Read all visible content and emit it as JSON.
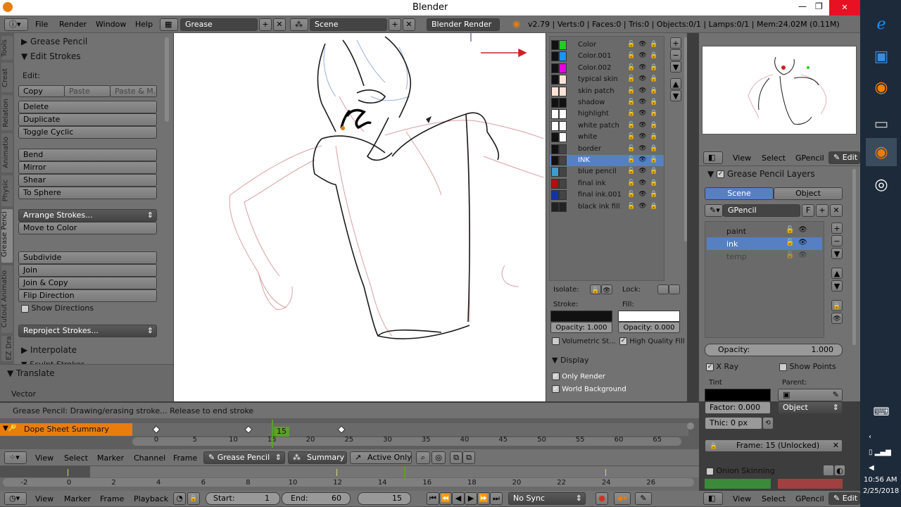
{
  "window": {
    "title": "Blender",
    "minimize": "—",
    "maximize": "❐",
    "close": "✕"
  },
  "topbar": {
    "menus": [
      "File",
      "Render",
      "Window",
      "Help"
    ],
    "screen": "Grease",
    "scene": "Scene",
    "engine": "Blender Render",
    "stats": "v2.79 | Verts:0 | Faces:0 | Tris:0 | Objects:0/1 | Lamps:0/1 | Mem:24.02M (0.11M)"
  },
  "tools": {
    "vtabs": [
      "Tools",
      "Creat",
      "Relation",
      "Animatio",
      "Physic",
      "Grease Penci",
      "Cutout Animatio",
      "EZ Dra"
    ],
    "grease_pencil": "Grease Pencil",
    "edit_strokes": "Edit Strokes",
    "edit_label": "Edit:",
    "copy": "Copy",
    "paste": "Paste",
    "paste_m": "Paste & M...",
    "g1": [
      "Delete",
      "Duplicate",
      "Toggle Cyclic"
    ],
    "g2": [
      "Bend",
      "Mirror",
      "Shear",
      "To Sphere"
    ],
    "arrange": "Arrange Strokes...",
    "move_color": "Move to Color",
    "g3": [
      "Subdivide",
      "Join",
      "Join & Copy",
      "Flip Direction"
    ],
    "show_dirs": "Show Directions",
    "reproject": "Reproject Strokes...",
    "interpolate": "Interpolate",
    "sculpt": "Sculpt Strokes",
    "translate": "Translate",
    "vector": "Vector"
  },
  "status": "Grease Pencil: Drawing/erasing stroke... Release to end stroke",
  "colors": {
    "items": [
      {
        "name": "Color",
        "stroke": "#111111",
        "fill": "#22cc22"
      },
      {
        "name": "Color.001",
        "stroke": "#111111",
        "fill": "#1e90ff"
      },
      {
        "name": "Color.002",
        "stroke": "#111111",
        "fill": "#e600e6"
      },
      {
        "name": "typical skin",
        "stroke": "#111111",
        "fill": "#fde3d6"
      },
      {
        "name": "skin patch",
        "stroke": "#fde3d6",
        "fill": "#fde3d6"
      },
      {
        "name": "shadow",
        "stroke": "#111111",
        "fill": "#111111"
      },
      {
        "name": "highlight",
        "stroke": "#ffffff",
        "fill": "#ffffff"
      },
      {
        "name": "white patch",
        "stroke": "#ffffff",
        "fill": "#ffffff"
      },
      {
        "name": "white",
        "stroke": "#111111",
        "fill": "#ffffff"
      },
      {
        "name": "border",
        "stroke": "#111111",
        "fill": "#444444"
      },
      {
        "name": "INK",
        "stroke": "#111111",
        "fill": "#444444"
      },
      {
        "name": "blue pencil",
        "stroke": "#3aa0c8",
        "fill": "#444444"
      },
      {
        "name": "final ink",
        "stroke": "#aa1111",
        "fill": "#444444"
      },
      {
        "name": "final ink.001",
        "stroke": "#1133aa",
        "fill": "#444444"
      },
      {
        "name": "black ink fill",
        "stroke": "#222222",
        "fill": "#222222"
      }
    ],
    "selected_index": 10,
    "isolate": "Isolate:",
    "lock": "Lock:",
    "stroke": "Stroke:",
    "fill": "Fill:",
    "stroke_opacity": "Opacity: 1.000",
    "fill_opacity": "Opacity: 0.000",
    "volumetric": "Volumetric St...",
    "hq_fill": "High Quality Fill",
    "display": "Display",
    "only_render": "Only Render",
    "world_bg": "World Background"
  },
  "right": {
    "menus": [
      "View",
      "Select",
      "GPencil"
    ],
    "edit": "Edit",
    "layers_title": "Grease Pencil Layers",
    "scene_tab": "Scene",
    "object_tab": "Object",
    "gpencil": "GPencil",
    "f": "F",
    "layers": [
      "paint",
      "ink",
      "temp"
    ],
    "active_layer": 1,
    "opacity_label": "Opacity:",
    "opacity_value": "1.000",
    "xray": "X Ray",
    "show_points": "Show Points",
    "tint": "Tint",
    "parent": "Parent:",
    "factor": "Factor: 0.000",
    "object": "Object",
    "thickness": "Thic: 0 px",
    "frame": "Frame: 15 (Unlocked)",
    "onion": "Onion Skinning"
  },
  "dopesheet": {
    "summary": "Dope Sheet Summary",
    "current_frame": "15",
    "ticks": [
      "0",
      "5",
      "10",
      "15",
      "20",
      "25",
      "30",
      "35",
      "40",
      "45",
      "50",
      "55",
      "60",
      "65"
    ],
    "keyframes": [
      0,
      12,
      24
    ],
    "menus": [
      "View",
      "Select",
      "Marker",
      "Channel",
      "Frame"
    ],
    "mode": "Grease Pencil",
    "summary_btn": "Summary",
    "active_only": "Active Only"
  },
  "timeline": {
    "ticks": [
      "-2",
      "0",
      "2",
      "4",
      "6",
      "8",
      "10",
      "12",
      "14",
      "16",
      "18",
      "20",
      "22",
      "24",
      "26"
    ],
    "menus": [
      "View",
      "Marker",
      "Frame",
      "Playback"
    ],
    "start": "Start:",
    "start_val": "1",
    "end": "End:",
    "end_val": "60",
    "current": "15",
    "sync": "No Sync"
  },
  "taskbar": {
    "time": "10:56 AM",
    "date": "2/25/2018"
  }
}
